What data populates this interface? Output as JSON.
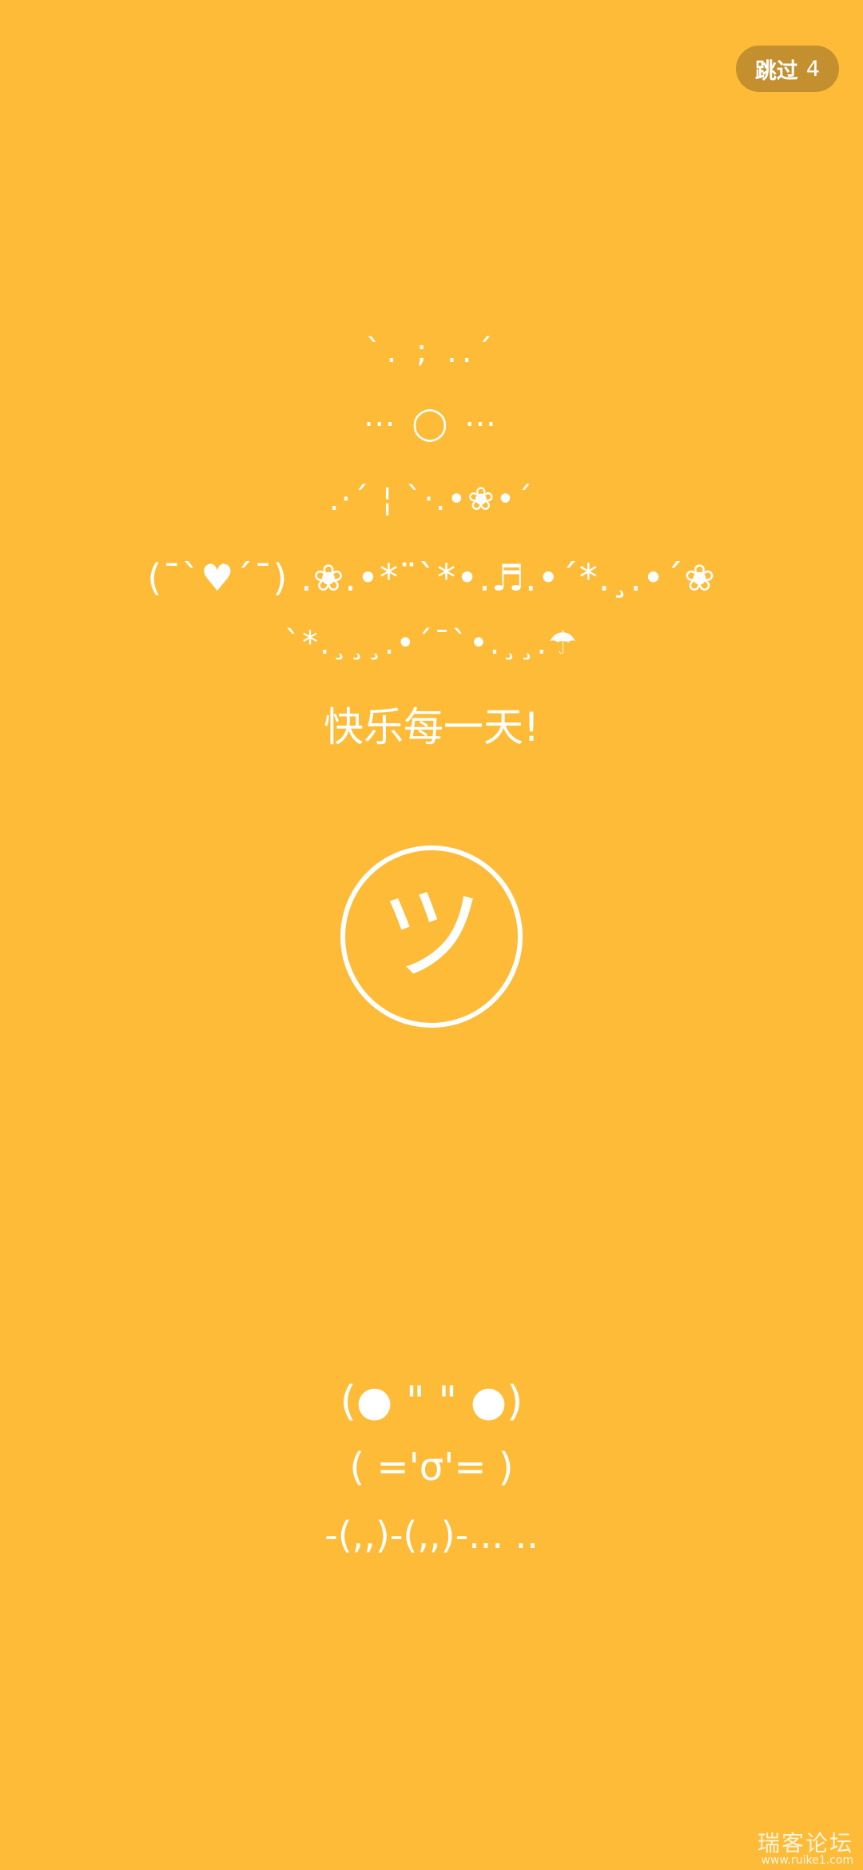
{
  "skip": {
    "label": "跳过",
    "count": "4"
  },
  "art_lines": [
    "`. ; ..´",
    "⋯ ◯ ⋯",
    ".·´ ¦ `·.•❀•´",
    "(¯`♥´¯) .❀.•*¨`*•.♬.•´*.¸.•´❀",
    "`*.¸¸¸.•´¯`•.¸¸.☂"
  ],
  "tagline": "快乐每一天!",
  "smiley": "ツ",
  "bottom_lines": [
    "(● \" \" ●)",
    "( ='σ'= )",
    "-(,,)-(,,)-... .."
  ],
  "watermark": {
    "name": "瑞客论坛",
    "url": "www.ruike1.com"
  },
  "colors": {
    "background": "#FDBB38",
    "foreground": "#FFFFFF"
  }
}
